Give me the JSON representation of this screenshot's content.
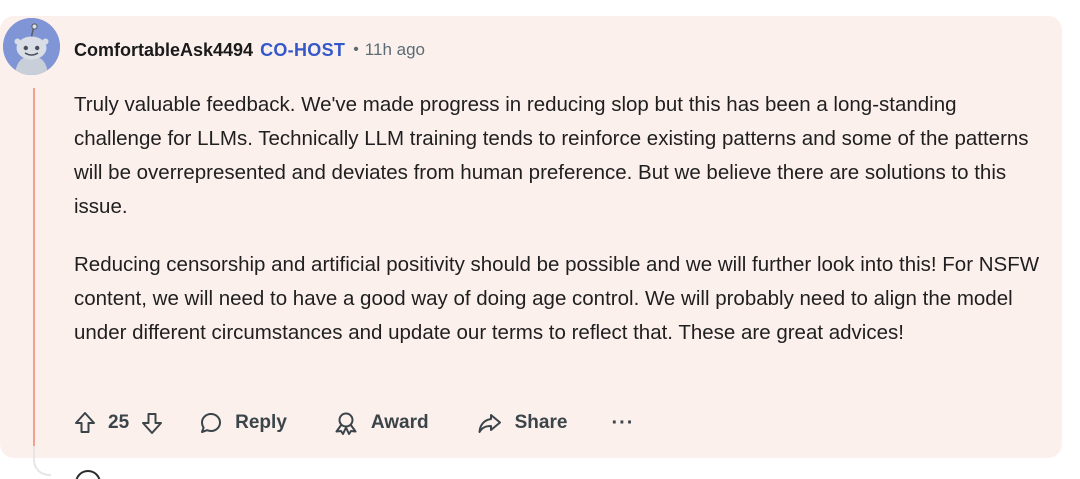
{
  "comment": {
    "author": "ComfortableAsk4494",
    "role": "CO-HOST",
    "separator": "•",
    "time": "11h ago",
    "paragraphs": [
      "Truly valuable feedback. We've made progress in reducing slop but this has been a long-standing challenge for LLMs. Technically LLM training tends to reinforce existing patterns and some of the patterns will be overrepresented and deviates from human preference. But we believe there are solutions to this issue.",
      "Reducing censorship and artificial positivity should be possible and we will further look into this! For NSFW content, we will need to have a good way of doing age control. We will probably need to align the model under different circumstances and update our terms to reflect that. These are great advices!"
    ]
  },
  "actions": {
    "vote_count": "25",
    "reply_label": "Reply",
    "award_label": "Award",
    "share_label": "Share",
    "more_label": "···"
  },
  "icons": {
    "upvote": "upvote-arrow-icon",
    "downvote": "downvote-arrow-icon",
    "reply": "speech-bubble-icon",
    "award": "award-ribbon-icon",
    "share": "share-arrow-icon",
    "more": "ellipsis-icon"
  },
  "colors": {
    "card_background": "#fcf0ed",
    "role_badge": "#3558c8",
    "thread_line": "#f0a28f",
    "avatar_background": "#7f95d6"
  }
}
